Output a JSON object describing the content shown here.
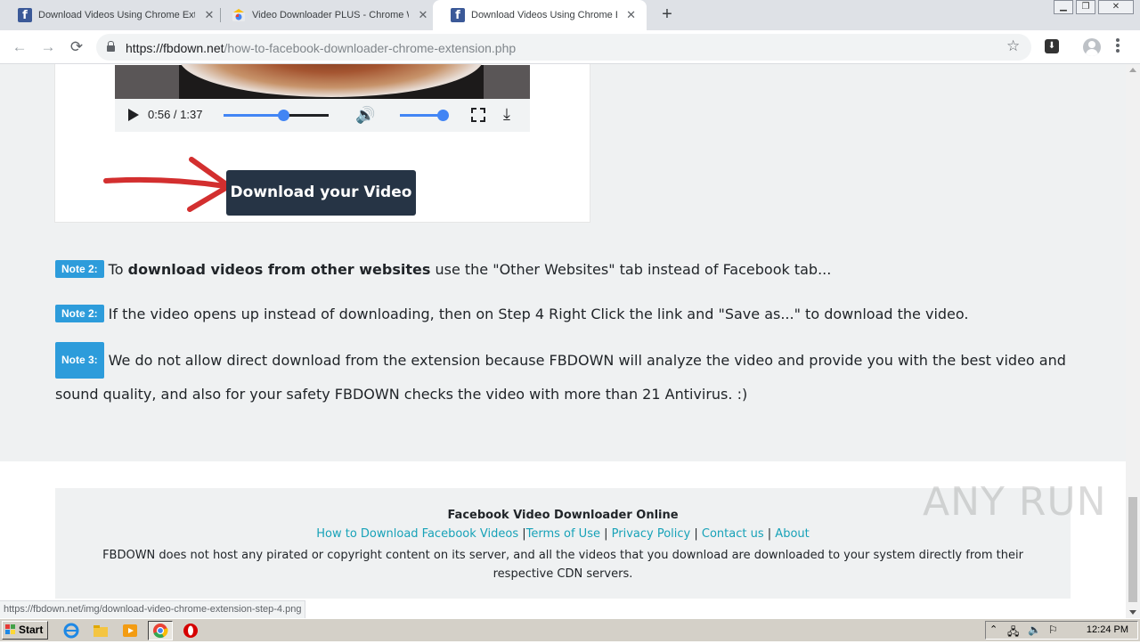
{
  "browser": {
    "tabs": [
      {
        "title": "Download Videos Using Chrome Exte",
        "icon": "facebook-icon",
        "active": false
      },
      {
        "title": "Video Downloader PLUS - Chrome We",
        "icon": "chrome-webstore-icon",
        "active": false
      },
      {
        "title": "Download Videos Using Chrome Exte",
        "icon": "facebook-icon",
        "active": true
      }
    ],
    "new_tab": "+",
    "url_host": "https://fbdown.net",
    "url_path": "/how-to-facebook-downloader-chrome-extension.php"
  },
  "video_player": {
    "time": "0:56 / 1:37",
    "progress": 0.57,
    "volume": 0.88
  },
  "download_button_label": "Download your Video",
  "notes": [
    {
      "badge": "Note 2:",
      "pre": "To ",
      "bold": "download videos from other websites",
      "post": " use the \"Other Websites\" tab instead of Facebook tab..."
    },
    {
      "badge": "Note 2:",
      "text": "If the video opens up instead of downloading, then on Step 4 Right Click the link and \"Save as...\" to download the video."
    },
    {
      "badge": "Note 3:",
      "text": "We do not allow direct download from the extension because FBDOWN will analyze the video and provide you with the best video and sound quality, and also for your safety FBDOWN checks the video with more than 21 Antivirus. :)"
    }
  ],
  "footer": {
    "title": "Facebook Video Downloader Online",
    "links": [
      "How to Download Facebook Videos",
      "Terms of Use",
      "Privacy Policy",
      "Contact us",
      "About"
    ],
    "text": "FBDOWN does not host any pirated or copyright content on its server, and all the videos that you download are downloaded to your system directly from their respective CDN servers."
  },
  "watermark": "ANY RUN",
  "status_url": "https://fbdown.net/img/download-video-chrome-extension-step-4.png",
  "taskbar": {
    "start_label": "Start",
    "clock": "12:24 PM"
  },
  "colors": {
    "accent_link": "#17a2b8",
    "badge": "#2d9cdb",
    "download_button": "#263445",
    "arrow": "#d32f2f"
  }
}
